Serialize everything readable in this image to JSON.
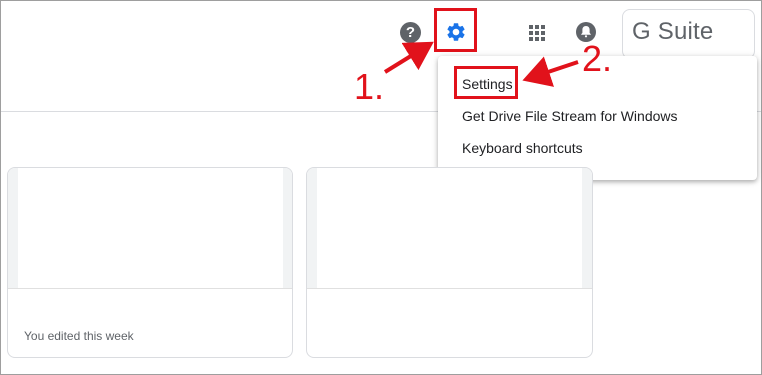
{
  "header": {
    "help_icon": "question-mark",
    "help_glyph": "?",
    "settings_icon": "gear-icon",
    "apps_icon": "apps-grid-icon",
    "notifications_icon": "bell-icon",
    "brand": "G Suite"
  },
  "settings_menu": {
    "items": [
      {
        "label": "Settings"
      },
      {
        "label": "Get Drive File Stream for Windows"
      },
      {
        "label": "Keyboard shortcuts"
      }
    ]
  },
  "files": {
    "cards": [
      {
        "meta": "You edited this week"
      },
      {
        "meta": ""
      }
    ]
  },
  "annotations": {
    "step1": "1.",
    "step2": "2.",
    "highlight_color": "#e1121b"
  },
  "colors": {
    "icon": "#5f6368",
    "gear": "#1a73e8",
    "border": "#dadce0"
  }
}
